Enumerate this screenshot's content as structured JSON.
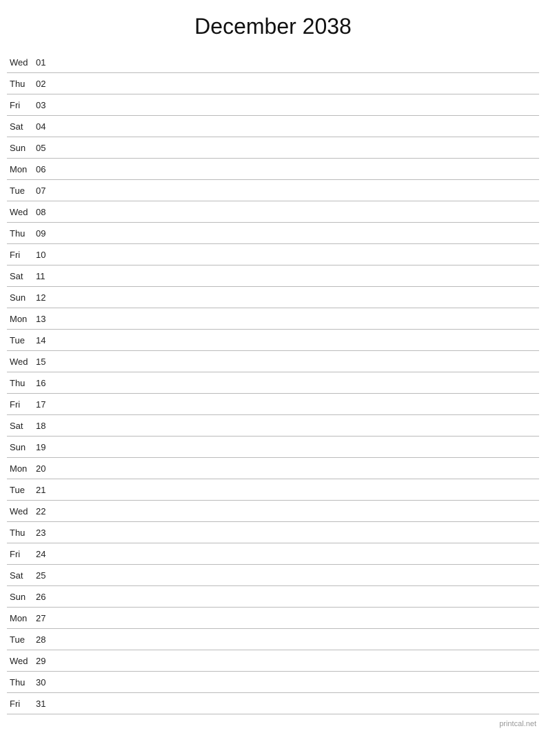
{
  "title": "December 2038",
  "footer": "printcal.net",
  "days": [
    {
      "name": "Wed",
      "num": "01"
    },
    {
      "name": "Thu",
      "num": "02"
    },
    {
      "name": "Fri",
      "num": "03"
    },
    {
      "name": "Sat",
      "num": "04"
    },
    {
      "name": "Sun",
      "num": "05"
    },
    {
      "name": "Mon",
      "num": "06"
    },
    {
      "name": "Tue",
      "num": "07"
    },
    {
      "name": "Wed",
      "num": "08"
    },
    {
      "name": "Thu",
      "num": "09"
    },
    {
      "name": "Fri",
      "num": "10"
    },
    {
      "name": "Sat",
      "num": "11"
    },
    {
      "name": "Sun",
      "num": "12"
    },
    {
      "name": "Mon",
      "num": "13"
    },
    {
      "name": "Tue",
      "num": "14"
    },
    {
      "name": "Wed",
      "num": "15"
    },
    {
      "name": "Thu",
      "num": "16"
    },
    {
      "name": "Fri",
      "num": "17"
    },
    {
      "name": "Sat",
      "num": "18"
    },
    {
      "name": "Sun",
      "num": "19"
    },
    {
      "name": "Mon",
      "num": "20"
    },
    {
      "name": "Tue",
      "num": "21"
    },
    {
      "name": "Wed",
      "num": "22"
    },
    {
      "name": "Thu",
      "num": "23"
    },
    {
      "name": "Fri",
      "num": "24"
    },
    {
      "name": "Sat",
      "num": "25"
    },
    {
      "name": "Sun",
      "num": "26"
    },
    {
      "name": "Mon",
      "num": "27"
    },
    {
      "name": "Tue",
      "num": "28"
    },
    {
      "name": "Wed",
      "num": "29"
    },
    {
      "name": "Thu",
      "num": "30"
    },
    {
      "name": "Fri",
      "num": "31"
    }
  ]
}
